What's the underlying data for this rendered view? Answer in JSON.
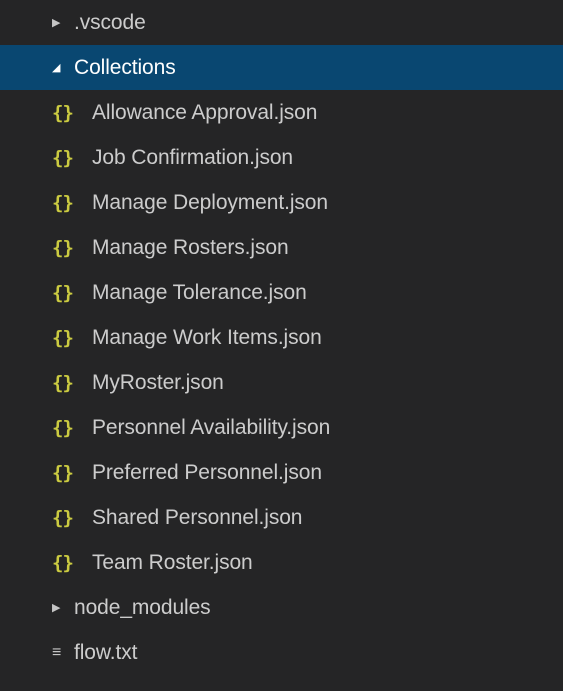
{
  "tree": {
    "vscode_folder": {
      "label": ".vscode",
      "expanded": false
    },
    "collections_folder": {
      "label": "Collections",
      "expanded": true,
      "selected": true
    },
    "collection_files": [
      "Allowance Approval.json",
      "Job Confirmation.json",
      "Manage Deployment.json",
      "Manage Rosters.json",
      "Manage Tolerance.json",
      "Manage Work Items.json",
      "MyRoster.json",
      "Personnel Availability.json",
      "Preferred Personnel.json",
      "Shared Personnel.json",
      "Team Roster.json"
    ],
    "node_modules_folder": {
      "label": "node_modules",
      "expanded": false
    },
    "flow_file": {
      "label": "flow.txt"
    }
  },
  "icons": {
    "collapsed": "chevron-right-icon",
    "expanded": "chevron-down-icon",
    "json": "json-file-icon",
    "txt": "text-file-icon"
  },
  "colors": {
    "background": "#252526",
    "selected": "#094771",
    "json_icon": "#cbcb41",
    "text": "#cccccc"
  }
}
